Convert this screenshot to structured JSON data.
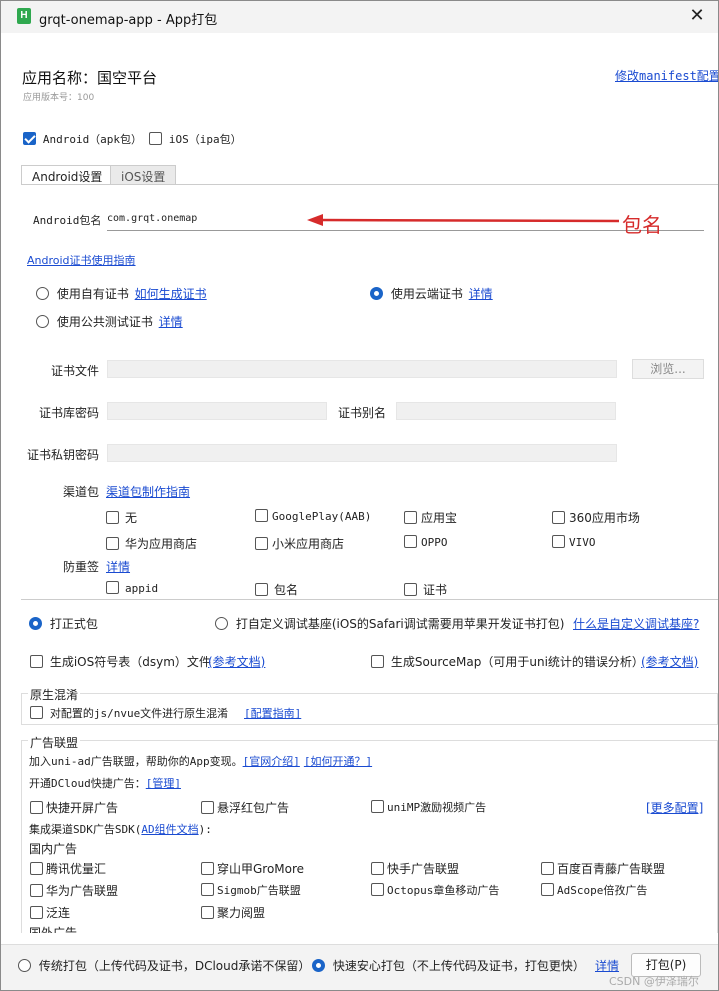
{
  "window": {
    "title": "grqt-onemap-app - App打包",
    "logo_letter": "H"
  },
  "header": {
    "app_name": "应用名称：国空平台",
    "version": "应用版本号：100",
    "manifest_link": "修改manifest配置"
  },
  "platforms": [
    {
      "label": "Android（apk包）",
      "checked": true
    },
    {
      "label": "iOS（ipa包）",
      "checked": false
    }
  ],
  "tabs": [
    {
      "label": "Android设置",
      "active": true
    },
    {
      "label": "iOS设置",
      "active": false
    }
  ],
  "android": {
    "package_label": "Android包名",
    "package_value": "com.grqt.onemap",
    "annotation": "包名",
    "cert_guide": "Android证书使用指南",
    "cert_options": [
      {
        "label": "使用自有证书",
        "link": "如何生成证书",
        "selected": false
      },
      {
        "label": "使用云端证书",
        "link": "详情",
        "selected": true
      },
      {
        "label": "使用公共测试证书",
        "link": "详情",
        "selected": false
      }
    ],
    "cert_file_label": "证书文件",
    "browse_label": "浏览...",
    "keystore_pwd_label": "证书库密码",
    "alias_label": "证书别名",
    "private_key_pwd_label": "证书私钥密码",
    "channel_label": "渠道包",
    "channel_guide": "渠道包制作指南",
    "channels": [
      "无",
      "GooglePlay(AAB)",
      "应用宝",
      "360应用市场",
      "华为应用商店",
      "小米应用商店",
      "OPPO",
      "VIVO"
    ],
    "anti_label": "防重签",
    "anti_link": "详情",
    "anti_items": [
      "appid",
      "包名",
      "证书"
    ]
  },
  "build_type": {
    "formal": "打正式包",
    "custom": "打自定义调试基座(iOS的Safari调试需要用苹果开发证书打包)",
    "custom_link": "什么是自定义调试基座?"
  },
  "extras": {
    "dsym": "生成iOS符号表（dsym）文件",
    "dsym_link": "(参考文档)",
    "sourcemap": "生成SourceMap（可用于uni统计的错误分析）",
    "sourcemap_link": "(参考文档)"
  },
  "obfuscation": {
    "title": "原生混淆",
    "option": "对配置的js/nvue文件进行原生混淆",
    "link": "[配置指南]"
  },
  "ads": {
    "title": "广告联盟",
    "intro": "加入uni-ad广告联盟，帮助你的App变现。",
    "intro_link1": "[官网介绍]",
    "intro_link2": "[如何开通？]",
    "dcloud_label": "开通DCloud快捷广告：",
    "dcloud_link": "[管理]",
    "dcloud_items": [
      "快捷开屏广告",
      "悬浮红包广告",
      "uniMP激励视频广告"
    ],
    "more_link": "[更多配置]",
    "sdk_label_prefix": "集成渠道SDK广告SDK(",
    "sdk_label_link": "AD组件文档",
    "sdk_label_suffix": "):",
    "domestic_label": "国内广告",
    "domestic_items": [
      "腾讯优量汇",
      "穿山甲GroMore",
      "快手广告联盟",
      "百度百青藤广告联盟",
      "华为广告联盟",
      "Sigmob广告联盟",
      "Octopus章鱼移动广告",
      "AdScope倍孜广告",
      "泛连",
      "聚力阅盟"
    ],
    "foreign_label": "国外广告"
  },
  "footer": {
    "mode1": "传统打包（上传代码及证书，DCloud承诺不保留）",
    "mode2": "快速安心打包（不上传代码及证书，打包更快）",
    "mode2_link": "详情",
    "pack_button": "打包(P)",
    "watermark": "CSDN @伊泽瑞尔"
  },
  "colors": {
    "accent": "#1a64c8",
    "link": "#1a4bd1",
    "annotation": "#d62b2b"
  }
}
